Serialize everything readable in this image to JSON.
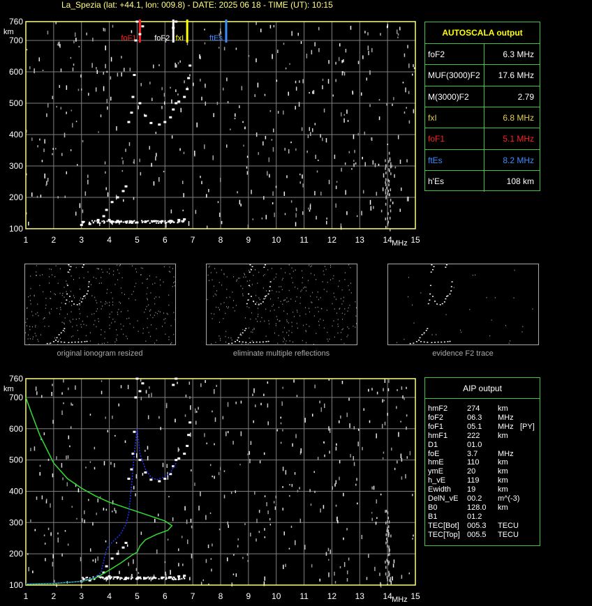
{
  "header": "La_Spezia (lat: +44.1, lon: 009.8) - DATE: 2025 06 18 - TIME (UT): 10:15",
  "colors": {
    "axis": "#ffff80",
    "grid": "#808080",
    "panel_border": "#44c244",
    "foF1": "#ff2020",
    "foF2": "#ffffff",
    "fxI": "#ffff00",
    "ftEs": "#3a8cff",
    "profile": "#33dd33",
    "trace_fit": "#2233ff"
  },
  "markers": [
    {
      "label": "foF1",
      "freq": 5.1,
      "color": "#ff2020"
    },
    {
      "label": "foF2",
      "freq": 6.3,
      "color": "#ffffff"
    },
    {
      "label": "fxI",
      "freq": 6.8,
      "color": "#ffff00"
    },
    {
      "label": "ftEs",
      "freq": 8.2,
      "color": "#3a8cff"
    }
  ],
  "autoscala": {
    "title": "AUTOSCALA output",
    "rows": [
      {
        "name": "foF2",
        "value": "6.3 MHz",
        "color": "#ffffff"
      },
      {
        "name": "MUF(3000)F2",
        "value": "17.6 MHz",
        "color": "#ffffff"
      },
      {
        "name": "M(3000)F2",
        "value": "2.79",
        "color": "#ffffff"
      },
      {
        "name": "fxI",
        "value": "6.8 MHz",
        "color": "#e0d050"
      },
      {
        "name": "foF1",
        "value": "5.1 MHz",
        "color": "#ff2020"
      },
      {
        "name": "ftEs",
        "value": "8.2 MHz",
        "color": "#3a8cff"
      },
      {
        "name": "h'Es",
        "value": "108     km",
        "color": "#ffffff"
      }
    ]
  },
  "aip": {
    "title": "AIP output",
    "rows": [
      {
        "name": "hmF2",
        "value": "274",
        "unit": "km",
        "extra": ""
      },
      {
        "name": "foF2",
        "value": "06.3",
        "unit": "MHz",
        "extra": ""
      },
      {
        "name": "foF1",
        "value": "05.1",
        "unit": "MHz",
        "extra": "[PY]"
      },
      {
        "name": "hmF1",
        "value": "222",
        "unit": "km",
        "extra": ""
      },
      {
        "name": "D1",
        "value": "01.0",
        "unit": "",
        "extra": ""
      },
      {
        "name": "foE",
        "value": "3.7",
        "unit": "MHz",
        "extra": ""
      },
      {
        "name": "hmE",
        "value": "110",
        "unit": "km",
        "extra": ""
      },
      {
        "name": "ymE",
        "value": "20",
        "unit": "km",
        "extra": ""
      },
      {
        "name": "h_vE",
        "value": "119",
        "unit": "km",
        "extra": ""
      },
      {
        "name": "Ewidth",
        "value": "19",
        "unit": "km",
        "extra": ""
      },
      {
        "name": "DelN_vE",
        "value": "00.2",
        "unit": "m^(-3)",
        "extra": ""
      },
      {
        "name": "B0",
        "value": "128.0",
        "unit": "km",
        "extra": ""
      },
      {
        "name": "B1",
        "value": "01.2",
        "unit": "",
        "extra": ""
      },
      {
        "name": "TEC[Bot]",
        "value": "005.3",
        "unit": "TECU",
        "extra": ""
      },
      {
        "name": "TEC[Top]",
        "value": "005.5",
        "unit": "TECU",
        "extra": ""
      }
    ]
  },
  "thumbnails": [
    {
      "caption": "original ionogram resized"
    },
    {
      "caption": "eliminate multiple reflections"
    },
    {
      "caption": "evidence F2 trace"
    }
  ],
  "chart_data": [
    {
      "type": "scatter",
      "title": "",
      "xlabel": "MHz",
      "ylabel": "km",
      "xlim": [
        1,
        15
      ],
      "ylim": [
        100,
        760
      ],
      "xticks": [
        1,
        2,
        3,
        4,
        5,
        6,
        7,
        8,
        9,
        10,
        11,
        12,
        13,
        14,
        15
      ],
      "yticks": [
        100,
        200,
        300,
        400,
        500,
        600,
        700,
        760
      ],
      "grid": true,
      "series": [
        {
          "name": "",
          "color": "#ffffff",
          "points": [
            [
              3.0,
              112
            ],
            [
              3.3,
              115
            ],
            [
              3.6,
              128
            ],
            [
              3.8,
              140
            ],
            [
              4.0,
              128
            ],
            [
              4.3,
              125
            ],
            [
              4.6,
              122
            ],
            [
              5.0,
              120
            ],
            [
              5.3,
              122
            ],
            [
              5.6,
              124
            ],
            [
              5.9,
              124
            ],
            [
              6.2,
              125
            ],
            [
              6.5,
              128
            ],
            [
              6.7,
              130
            ],
            [
              3.9,
              160
            ],
            [
              4.1,
              185
            ],
            [
              4.3,
              200
            ],
            [
              4.5,
              220
            ],
            [
              4.6,
              235
            ],
            [
              4.7,
              440
            ],
            [
              4.8,
              470
            ],
            [
              4.85,
              520
            ],
            [
              4.9,
              590
            ],
            [
              4.95,
              700
            ],
            [
              5.0,
              760
            ],
            [
              5.1,
              500
            ],
            [
              5.3,
              460
            ],
            [
              5.5,
              437
            ],
            [
              5.8,
              432
            ],
            [
              6.0,
              440
            ],
            [
              6.2,
              455
            ],
            [
              6.3,
              480
            ],
            [
              6.4,
              500
            ],
            [
              6.5,
              505
            ],
            [
              6.7,
              520
            ],
            [
              6.8,
              545
            ],
            [
              6.85,
              580
            ],
            [
              6.9,
              620
            ],
            [
              5.1,
              720
            ],
            [
              5.2,
              745
            ],
            [
              6.3,
              740
            ],
            [
              6.4,
              760
            ]
          ]
        }
      ]
    },
    {
      "type": "line",
      "title": "",
      "xlabel": "MHz",
      "ylabel": "km",
      "xlim": [
        1,
        15
      ],
      "ylim": [
        100,
        760
      ],
      "xticks": [
        1,
        2,
        3,
        4,
        5,
        6,
        7,
        8,
        9,
        10,
        11,
        12,
        13,
        14,
        15
      ],
      "yticks": [
        100,
        200,
        300,
        400,
        500,
        600,
        700,
        760
      ],
      "grid": true,
      "series": [
        {
          "name": "",
          "color": "#33dd33",
          "points": [
            [
              1.0,
              700
            ],
            [
              1.2,
              650
            ],
            [
              1.5,
              580
            ],
            [
              2.0,
              490
            ],
            [
              2.5,
              440
            ],
            [
              3.0,
              410
            ],
            [
              3.5,
              385
            ],
            [
              4.0,
              365
            ],
            [
              4.5,
              350
            ],
            [
              5.0,
              335
            ],
            [
              5.5,
              320
            ],
            [
              6.0,
              305
            ],
            [
              6.25,
              290
            ],
            [
              6.1,
              275
            ],
            [
              5.7,
              262
            ],
            [
              5.3,
              245
            ],
            [
              5.1,
              225
            ],
            [
              5.0,
              205
            ],
            [
              4.8,
              195
            ],
            [
              4.4,
              170
            ],
            [
              4.0,
              148
            ],
            [
              3.7,
              132
            ],
            [
              3.5,
              122
            ],
            [
              3.0,
              112
            ],
            [
              2.0,
              105
            ],
            [
              1.0,
              103
            ]
          ]
        },
        {
          "name": "",
          "color": "#2233ff",
          "points": [
            [
              1.0,
              104
            ],
            [
              2.0,
              106
            ],
            [
              3.0,
              112
            ],
            [
              3.5,
              125
            ],
            [
              3.7,
              140
            ],
            [
              3.9,
              215
            ],
            [
              4.0,
              228
            ],
            [
              4.2,
              245
            ],
            [
              4.4,
              262
            ],
            [
              4.6,
              295
            ],
            [
              4.7,
              330
            ],
            [
              4.8,
              420
            ],
            [
              4.9,
              520
            ],
            [
              5.0,
              600
            ],
            [
              5.1,
              520
            ],
            [
              5.3,
              470
            ],
            [
              5.5,
              445
            ],
            [
              5.7,
              437
            ],
            [
              6.0,
              446
            ],
            [
              6.2,
              460
            ],
            [
              6.4,
              490
            ]
          ]
        }
      ]
    }
  ]
}
